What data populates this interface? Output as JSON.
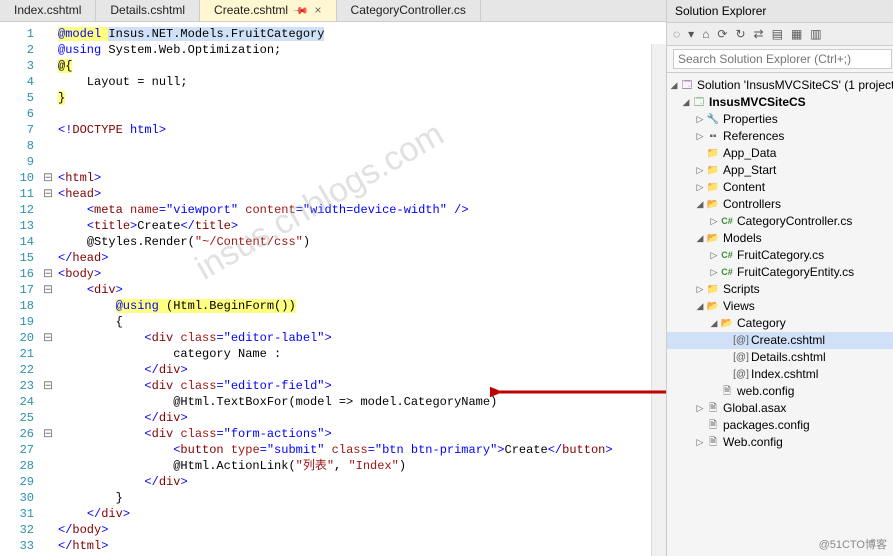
{
  "tabs": [
    {
      "label": "Index.cshtml"
    },
    {
      "label": "Details.cshtml"
    },
    {
      "label": "Create.cshtml",
      "active": true
    },
    {
      "label": "CategoryController.cs"
    }
  ],
  "code": {
    "lines": [
      {
        "n": 1,
        "html": "<span class='hl-yellow'><span class='kw-blue'>@model</span> <span class='hl-sel'>Insus.NET.Models.FruitCategory</span></span>"
      },
      {
        "n": 2,
        "html": "<span class='kw-blue'>@using</span> System.Web.Optimization;"
      },
      {
        "n": 3,
        "html": "<span class='hl-yellow'>@{</span>"
      },
      {
        "n": 4,
        "html": "    Layout = null;"
      },
      {
        "n": 5,
        "html": "<span class='hl-yellow'>}</span>"
      },
      {
        "n": 6,
        "html": ""
      },
      {
        "n": 7,
        "html": "<span class='kw-blue'>&lt;!</span><span class='kw-maroon'>DOCTYPE</span> <span class='kw-blue'>html&gt;</span>"
      },
      {
        "n": 8,
        "html": ""
      },
      {
        "n": 9,
        "html": ""
      },
      {
        "n": 10,
        "fold": "⊟",
        "html": "<span class='kw-blue'>&lt;</span><span class='kw-maroon'>html</span><span class='kw-blue'>&gt;</span>"
      },
      {
        "n": 11,
        "fold": "⊟",
        "html": "<span class='kw-blue'>&lt;</span><span class='kw-maroon'>head</span><span class='kw-blue'>&gt;</span>"
      },
      {
        "n": 12,
        "html": "    <span class='kw-blue'>&lt;</span><span class='kw-maroon'>meta</span> <span class='kw-red'>name</span><span class='kw-blue'>=\"viewport\"</span> <span class='kw-red'>content</span><span class='kw-blue'>=\"width=device-width\"</span> <span class='kw-blue'>/&gt;</span>"
      },
      {
        "n": 13,
        "html": "    <span class='kw-blue'>&lt;</span><span class='kw-maroon'>title</span><span class='kw-blue'>&gt;</span>Create<span class='kw-blue'>&lt;/</span><span class='kw-maroon'>title</span><span class='kw-blue'>&gt;</span>"
      },
      {
        "n": 14,
        "html": "    <span class='kw-black'>@</span>Styles.Render(<span class='kw-red'>\"~/Content/css\"</span>)"
      },
      {
        "n": 15,
        "html": "<span class='kw-blue'>&lt;/</span><span class='kw-maroon'>head</span><span class='kw-blue'>&gt;</span>"
      },
      {
        "n": 16,
        "fold": "⊟",
        "html": "<span class='kw-blue'>&lt;</span><span class='kw-maroon'>body</span><span class='kw-blue'>&gt;</span>"
      },
      {
        "n": 17,
        "fold": "⊟",
        "html": "    <span class='kw-blue'>&lt;</span><span class='kw-maroon'>div</span><span class='kw-blue'>&gt;</span>"
      },
      {
        "n": 18,
        "html": "        <span class='hl-yellow'><span class='kw-blue'>@using</span> (Html.BeginForm())</span>"
      },
      {
        "n": 19,
        "html": "        {"
      },
      {
        "n": 20,
        "fold": "⊟",
        "html": "            <span class='kw-blue'>&lt;</span><span class='kw-maroon'>div</span> <span class='kw-red'>class</span><span class='kw-blue'>=\"editor-label\"&gt;</span>"
      },
      {
        "n": 21,
        "html": "                category Name :"
      },
      {
        "n": 22,
        "html": "            <span class='kw-blue'>&lt;/</span><span class='kw-maroon'>div</span><span class='kw-blue'>&gt;</span>"
      },
      {
        "n": 23,
        "fold": "⊟",
        "html": "            <span class='kw-blue'>&lt;</span><span class='kw-maroon'>div</span> <span class='kw-red'>class</span><span class='kw-blue'>=\"editor-field\"&gt;</span>"
      },
      {
        "n": 24,
        "html": "                <span class='kw-black'>@</span>Html.TextBoxFor(model =&gt; model.CategoryName)"
      },
      {
        "n": 25,
        "html": "            <span class='kw-blue'>&lt;/</span><span class='kw-maroon'>div</span><span class='kw-blue'>&gt;</span>"
      },
      {
        "n": 26,
        "fold": "⊟",
        "html": "            <span class='kw-blue'>&lt;</span><span class='kw-maroon'>div</span> <span class='kw-red'>class</span><span class='kw-blue'>=\"form-actions\"&gt;</span>"
      },
      {
        "n": 27,
        "html": "                <span class='kw-blue'>&lt;</span><span class='kw-maroon'>button</span> <span class='kw-red'>type</span><span class='kw-blue'>=\"submit\"</span> <span class='kw-red'>class</span><span class='kw-blue'>=\"btn btn-primary\"&gt;</span>Create<span class='kw-blue'>&lt;/</span><span class='kw-maroon'>button</span><span class='kw-blue'>&gt;</span>"
      },
      {
        "n": 28,
        "html": "                <span class='kw-black'>@</span>Html.ActionLink(<span class='kw-red'>\"列表\"</span>, <span class='kw-red'>\"Index\"</span>)"
      },
      {
        "n": 29,
        "html": "            <span class='kw-blue'>&lt;/</span><span class='kw-maroon'>div</span><span class='kw-blue'>&gt;</span>"
      },
      {
        "n": 30,
        "html": "        }"
      },
      {
        "n": 31,
        "html": "    <span class='kw-blue'>&lt;/</span><span class='kw-maroon'>div</span><span class='kw-blue'>&gt;</span>"
      },
      {
        "n": 32,
        "html": "<span class='kw-blue'>&lt;/</span><span class='kw-maroon'>body</span><span class='kw-blue'>&gt;</span>"
      },
      {
        "n": 33,
        "html": "<span class='kw-blue'>&lt;/</span><span class='kw-maroon'>html</span><span class='kw-blue'>&gt;</span>"
      }
    ]
  },
  "explorer": {
    "title": "Solution Explorer",
    "searchPlaceholder": "Search Solution Explorer (Ctrl+;)",
    "solution": "Solution 'InsusMVCSiteCS' (1 project",
    "project": "InsusMVCSiteCS",
    "nodes": {
      "properties": "Properties",
      "references": "References",
      "appdata": "App_Data",
      "appstart": "App_Start",
      "content": "Content",
      "controllers": "Controllers",
      "controllerFile": "CategoryController.cs",
      "models": "Models",
      "modelsF1": "FruitCategory.cs",
      "modelsF2": "FruitCategoryEntity.cs",
      "scripts": "Scripts",
      "views": "Views",
      "category": "Category",
      "create": "Create.cshtml",
      "details": "Details.cshtml",
      "index": "Index.cshtml",
      "webconfig1": "web.config",
      "global": "Global.asax",
      "packages": "packages.config",
      "webconfig2": "Web.config"
    }
  },
  "watermark": "insus.cnblogs.com",
  "credit": "@51CTO博客"
}
